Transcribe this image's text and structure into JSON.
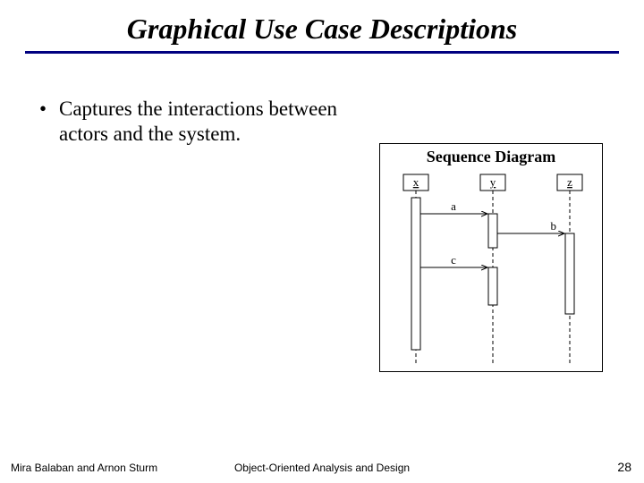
{
  "title": "Graphical Use Case Descriptions",
  "bullet": "Captures the interactions between actors and the system.",
  "sequence": {
    "title": "Sequence Diagram",
    "participants": [
      "x",
      "y",
      "z"
    ],
    "messages": [
      "a",
      "b",
      "c"
    ]
  },
  "footer": {
    "left": "Mira Balaban and Arnon Sturm",
    "center": "Object-Oriented Analysis and Design",
    "page": "28"
  }
}
